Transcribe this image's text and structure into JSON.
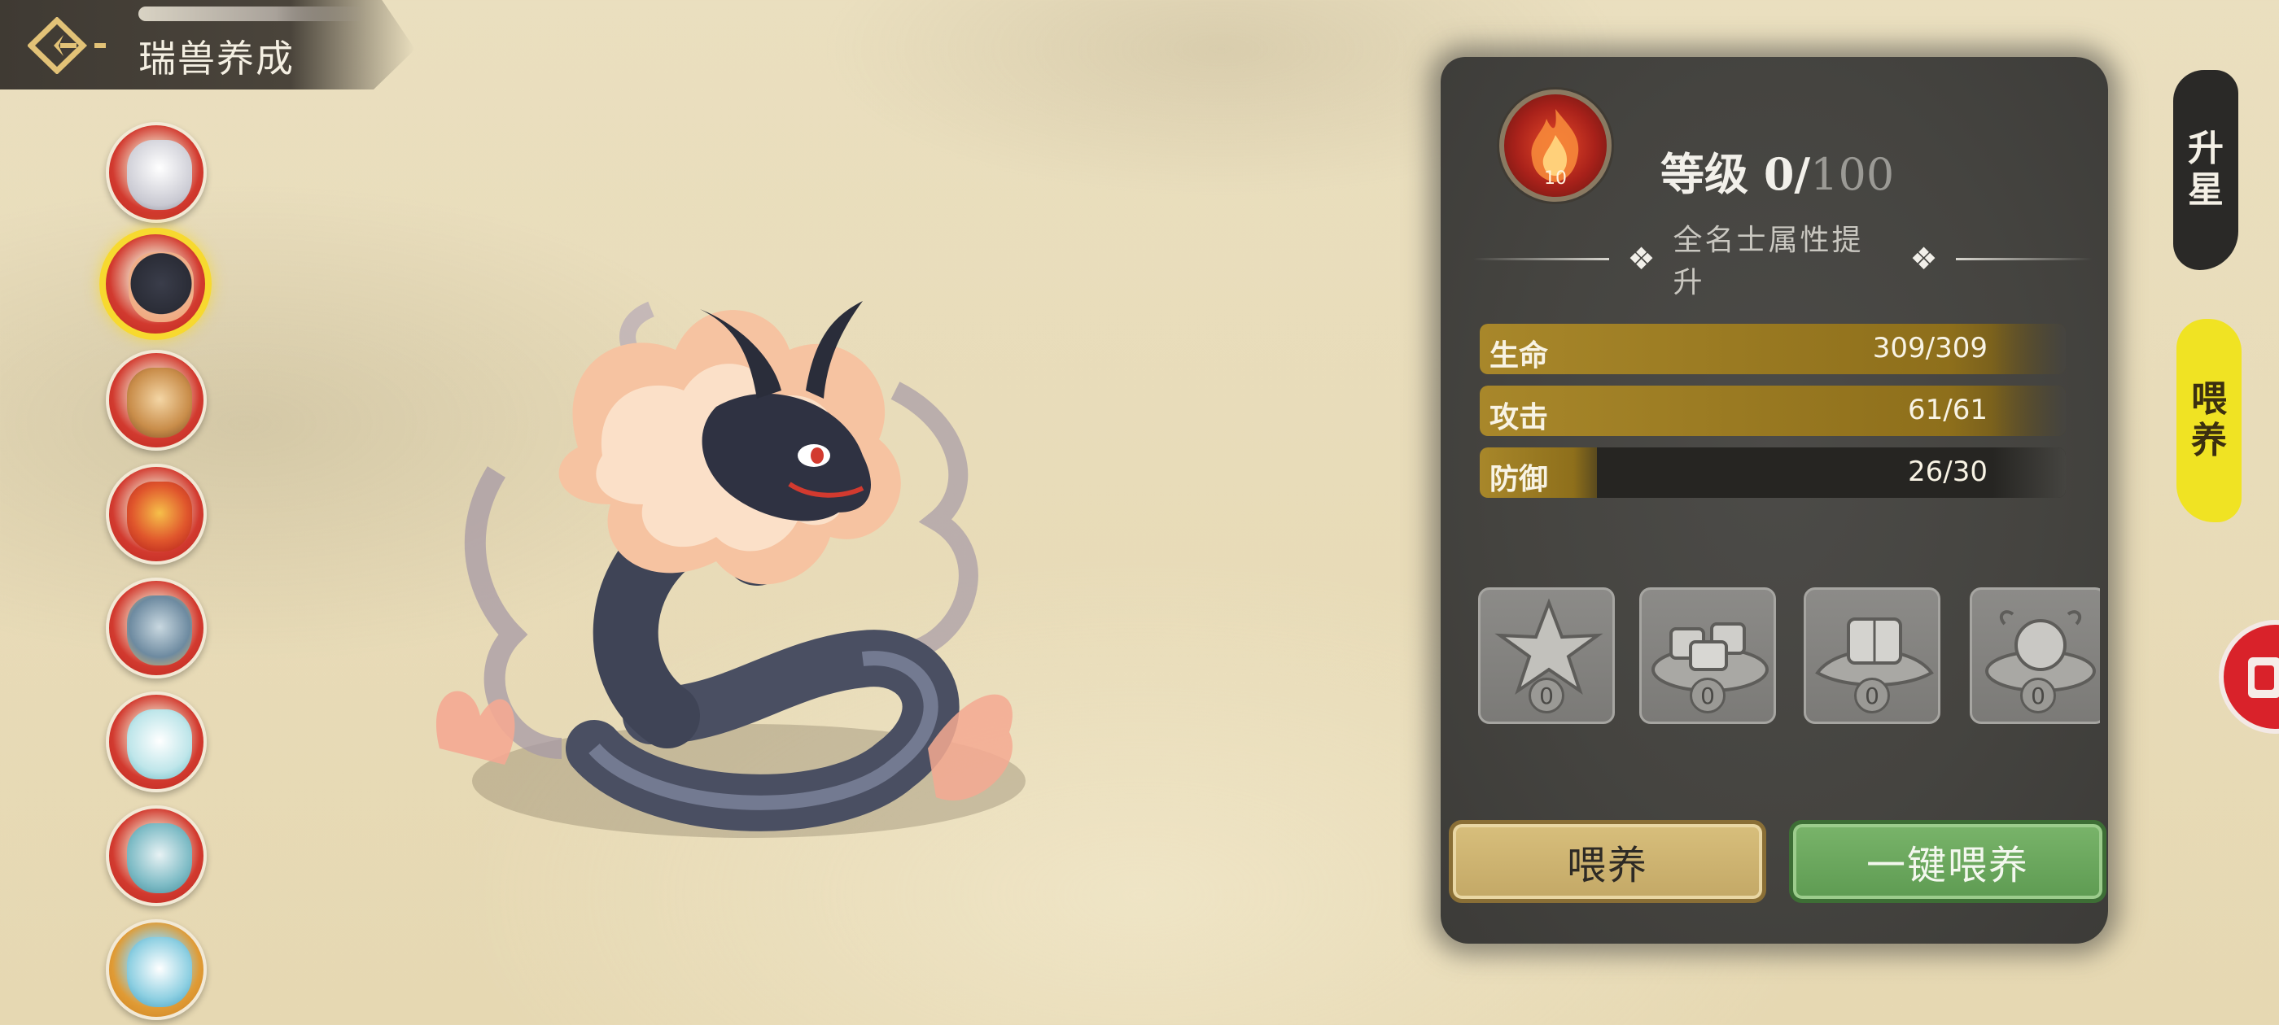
{
  "header": {
    "title": "瑞兽养成"
  },
  "level": {
    "prefix": "等级 ",
    "current": "0",
    "separator": "/",
    "max": "100",
    "badge_number": "10"
  },
  "panel": {
    "subtitle": "全名士属性提升"
  },
  "stats": [
    {
      "label": "生命",
      "value": "309/309",
      "fill": 1.0
    },
    {
      "label": "攻击",
      "value": "61/61",
      "fill": 1.0
    },
    {
      "label": "防御",
      "value": "26/30",
      "fill": 0.2
    }
  ],
  "items": [
    {
      "icon": "star-stone-icon",
      "count": "0"
    },
    {
      "icon": "tofu-plate-icon",
      "count": "0"
    },
    {
      "icon": "cake-leaf-icon",
      "count": "0"
    },
    {
      "icon": "dumpling-plate-icon",
      "count": "0"
    }
  ],
  "buttons": {
    "feed": "喂养",
    "feed_all": "一键喂养"
  },
  "tabs": {
    "star_up": [
      "升",
      "星"
    ],
    "feed": [
      "喂",
      "养"
    ]
  },
  "beasts": [
    {
      "icon": "white-tiger-icon"
    },
    {
      "icon": "black-dragon-icon",
      "selected": true
    },
    {
      "icon": "lion-icon"
    },
    {
      "icon": "phoenix-icon"
    },
    {
      "icon": "azure-dragon-icon"
    },
    {
      "icon": "white-crane-icon"
    },
    {
      "icon": "teal-dragon-icon"
    },
    {
      "icon": "golden-qilin-icon"
    }
  ],
  "colors": {
    "gold_fill": "#a8872a",
    "panel": "#454440",
    "feed_button": "#c3a866",
    "feed_all_button": "#5e9b52",
    "active_tab": "#f0e323",
    "selected_ring": "#f7d92f"
  }
}
